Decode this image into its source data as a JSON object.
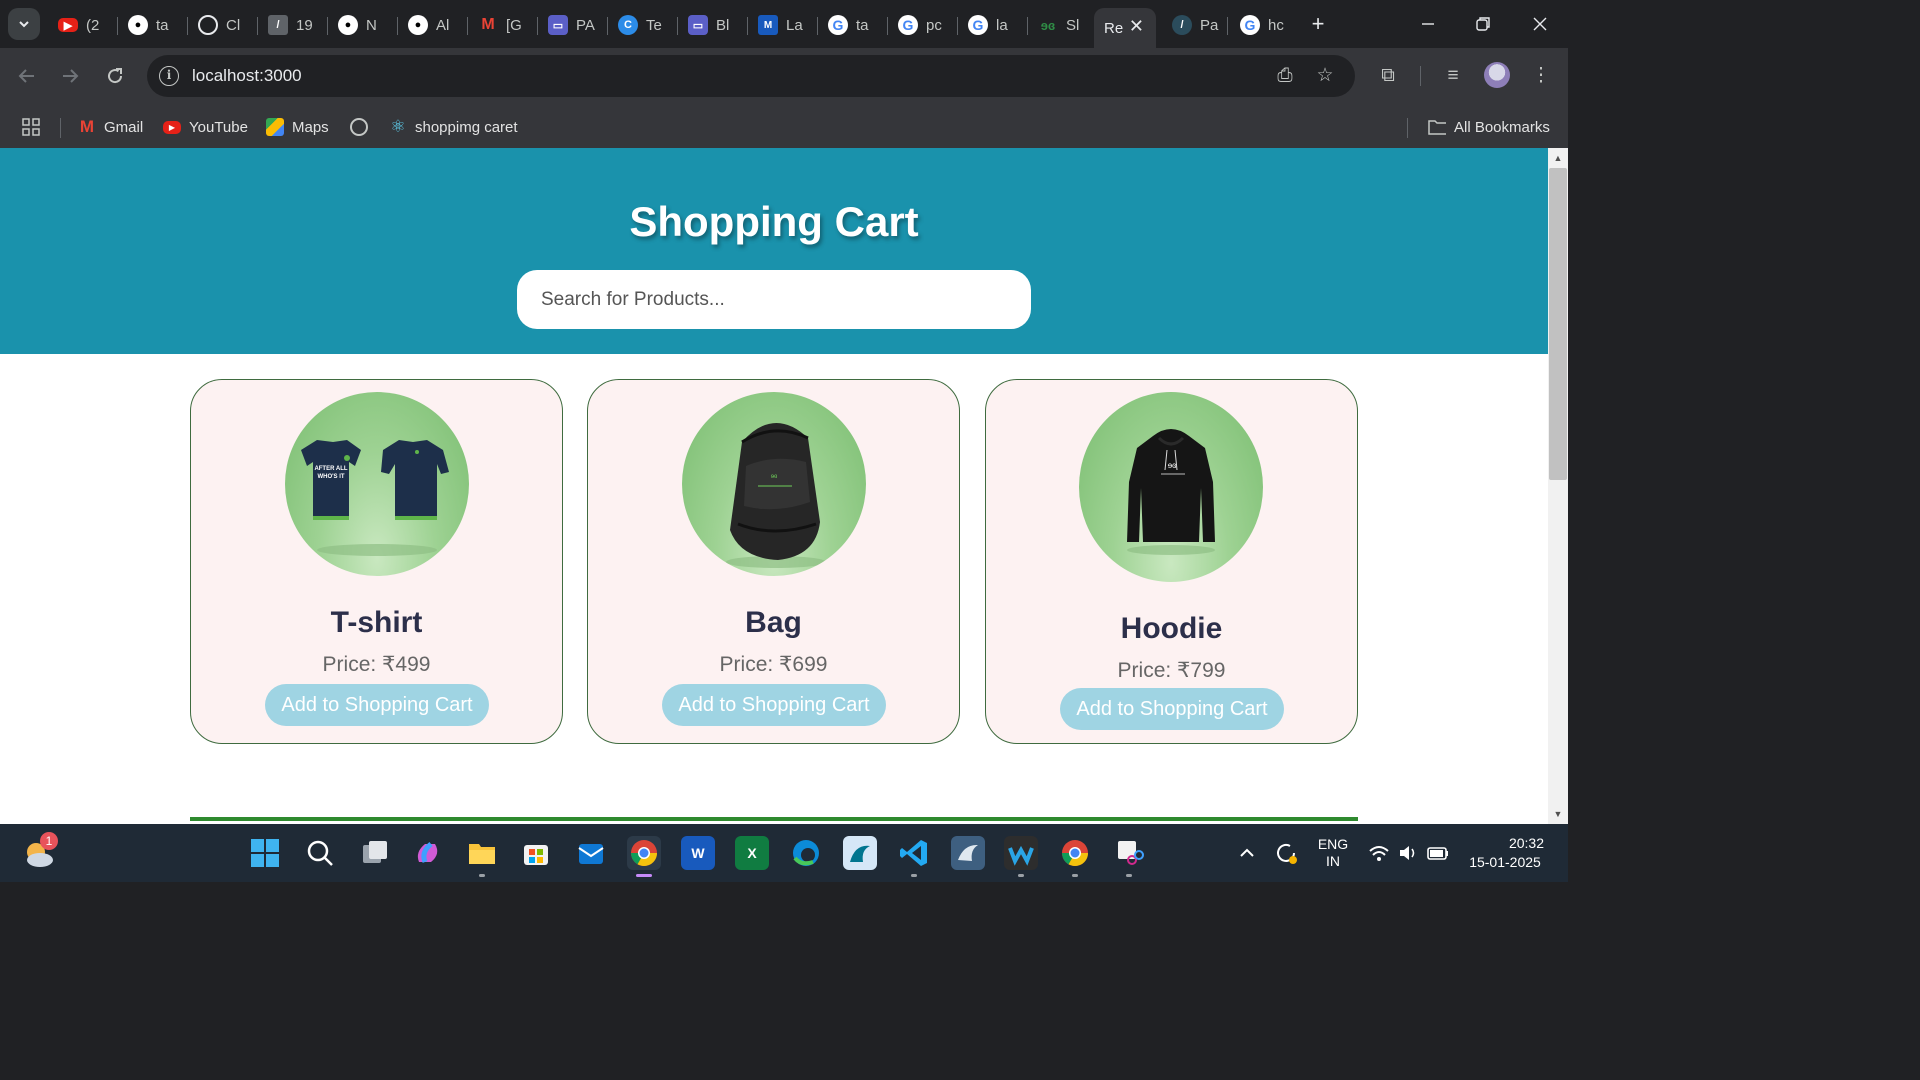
{
  "browser": {
    "tabs": [
      {
        "title": "(2",
        "favicon": "youtube-icon"
      },
      {
        "title": "ta",
        "favicon": "github-icon"
      },
      {
        "title": "Cl",
        "favicon": "chatgpt-icon"
      },
      {
        "title": "19",
        "favicon": "pen-icon"
      },
      {
        "title": "N",
        "favicon": "github-icon"
      },
      {
        "title": "Al",
        "favicon": "github-icon"
      },
      {
        "title": "[G",
        "favicon": "gmail-icon"
      },
      {
        "title": "PA",
        "favicon": "teams-icon"
      },
      {
        "title": "Te",
        "favicon": "canva-icon"
      },
      {
        "title": "Bl",
        "favicon": "teams-icon"
      },
      {
        "title": "La",
        "favicon": "word-icon"
      },
      {
        "title": "ta",
        "favicon": "google-icon"
      },
      {
        "title": "pc",
        "favicon": "google-icon"
      },
      {
        "title": "la",
        "favicon": "google-icon"
      },
      {
        "title": "Sl",
        "favicon": "geeksforgeeks-icon"
      },
      {
        "title": "Re",
        "favicon": "react-icon",
        "active": true
      },
      {
        "title": "Pa",
        "favicon": "pen-icon"
      },
      {
        "title": "hc",
        "favicon": "google-icon"
      }
    ],
    "url": "localhost:3000",
    "bookmarks": [
      {
        "label": "Gmail",
        "icon": "gmail-icon"
      },
      {
        "label": "YouTube",
        "icon": "youtube-icon"
      },
      {
        "label": "Maps",
        "icon": "maps-icon"
      },
      {
        "label": "",
        "icon": "globe-icon"
      },
      {
        "label": "shoppimg caret",
        "icon": "react-icon"
      }
    ],
    "all_bookmarks_label": "All Bookmarks"
  },
  "page": {
    "title": "Shopping Cart",
    "search_placeholder": "Search for Products...",
    "colors": {
      "header": "#1a92ac",
      "card_bg": "#fdf2f2",
      "card_border": "#3f6b3f",
      "button": "#9fd4e3",
      "divider": "#2f8a2f"
    },
    "products": [
      {
        "name": "T-shirt",
        "price": "Price: ₹499",
        "button": "Add to Shopping Cart",
        "image": "tshirt-image"
      },
      {
        "name": "Bag",
        "price": "Price: ₹699",
        "button": "Add to Shopping Cart",
        "image": "bag-image"
      },
      {
        "name": "Hoodie",
        "price": "Price: ₹799",
        "button": "Add to Shopping Cart",
        "image": "hoodie-image"
      }
    ]
  },
  "taskbar": {
    "weather_badge": "1",
    "language": "ENG",
    "region": "IN",
    "time": "20:32",
    "date": "15-01-2025"
  }
}
